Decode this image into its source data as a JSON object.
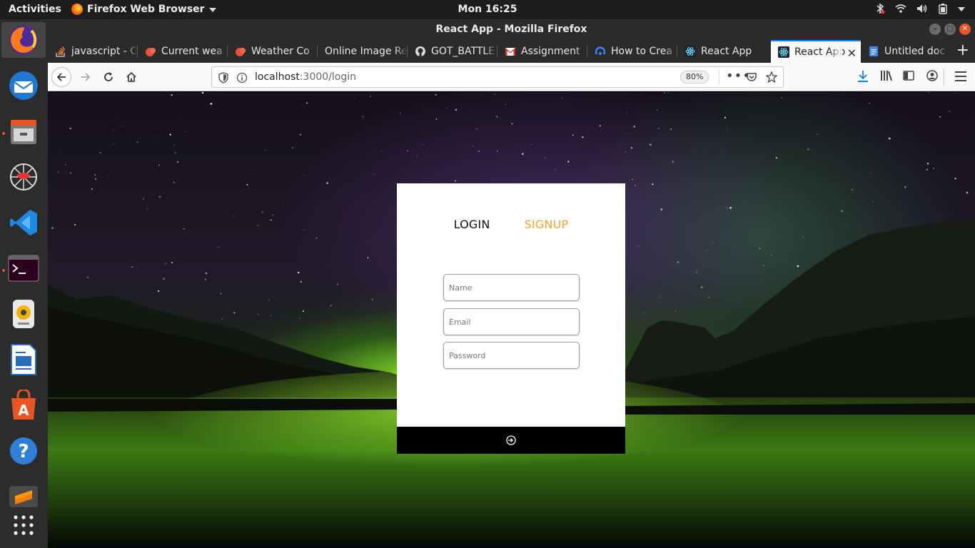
{
  "topbar": {
    "activities": "Activities",
    "app_name": "Firefox Web Browser",
    "clock": "Mon 16:25"
  },
  "dock": {
    "items": [
      "firefox-icon",
      "thunderbird-icon",
      "files-icon",
      "zap-icon",
      "vscode-icon",
      "terminal-icon",
      "rhythmbox-icon",
      "libreoffice-writer-icon",
      "software-center-icon",
      "help-icon",
      "sublime-icon",
      "show-apps-icon"
    ]
  },
  "window": {
    "title": "React App - Mozilla Firefox"
  },
  "tabs": [
    {
      "label": "javascript - C",
      "icon": "stackoverflow-icon"
    },
    {
      "label": "Current wea",
      "icon": "weather-icon"
    },
    {
      "label": "Weather Co",
      "icon": "weather-icon"
    },
    {
      "label": "Online Image Re",
      "icon": "blank-icon"
    },
    {
      "label": "GOT_BATTLE",
      "icon": "github-icon"
    },
    {
      "label": "Assignment",
      "icon": "gmail-icon"
    },
    {
      "label": "How to Crea",
      "icon": "generic-icon"
    },
    {
      "label": "React App",
      "icon": "react-icon"
    },
    {
      "label": "React App",
      "icon": "react-icon",
      "active": true
    },
    {
      "label": "Untitled doc",
      "icon": "docs-icon"
    }
  ],
  "navbar": {
    "url_host": "localhost",
    "url_path": ":3000/login",
    "zoom": "80%"
  },
  "login": {
    "tab_login": "LOGIN",
    "tab_signup": "SIGNUP",
    "name_placeholder": "Name",
    "email_placeholder": "Email",
    "password_placeholder": "Password",
    "accent_color": "#f9a12b"
  }
}
